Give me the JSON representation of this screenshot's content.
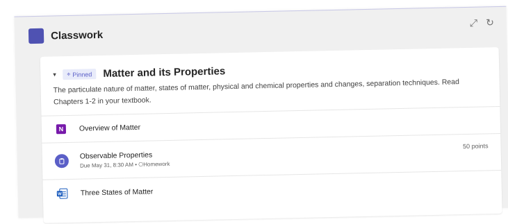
{
  "header": {
    "title": "Classwork",
    "expand_icon": "expand-icon",
    "refresh_icon": "refresh-icon"
  },
  "module": {
    "pinned_label": "Pinned",
    "title": "Matter and its Properties",
    "description": "The particulate nature of matter, states of matter, physical and chemical properties and changes, separation techniques. Read Chapters 1-2 in your textbook."
  },
  "items": [
    {
      "type": "onenote",
      "icon": "onenote-icon",
      "title": "Overview of Matter"
    },
    {
      "type": "assignment",
      "icon": "assignment-icon",
      "title": "Observable Properties",
      "subtitle": "Due May 31, 8:30 AM • ⎔Homework",
      "points": "50 points"
    },
    {
      "type": "word",
      "icon": "word-icon",
      "title": "Three States of Matter"
    }
  ],
  "colors": {
    "accent": "#5b5fc7",
    "app_tile": "#4f52b2",
    "onenote": "#7719aa",
    "word": "#185abd"
  }
}
